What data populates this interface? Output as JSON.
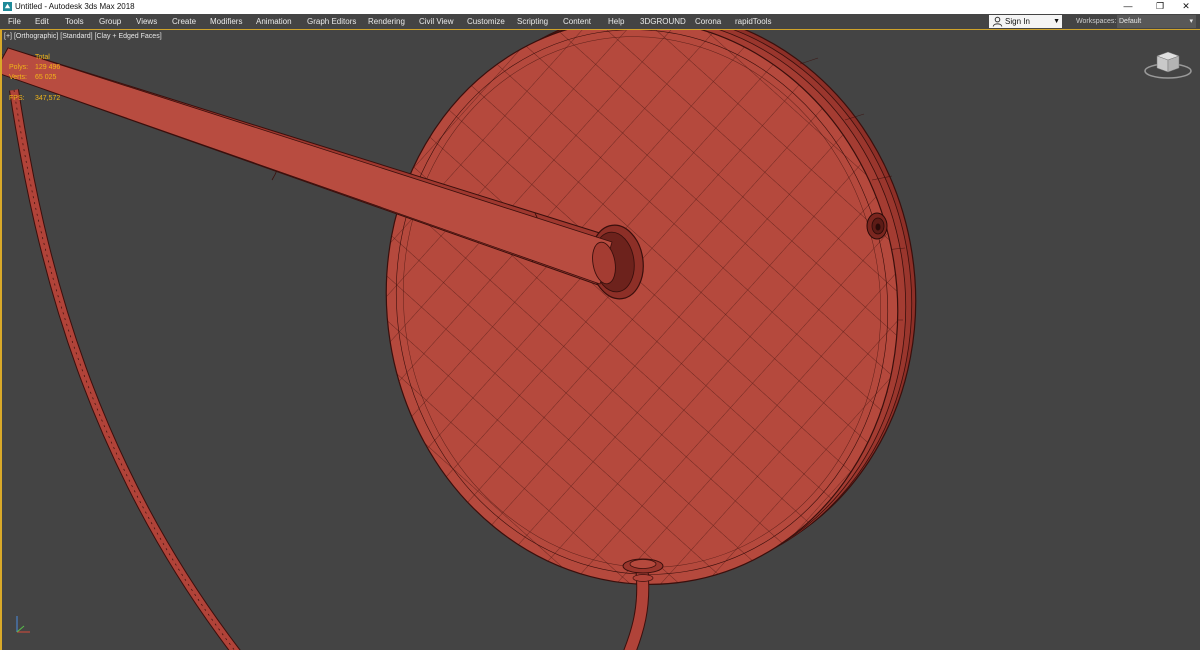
{
  "window": {
    "title": "Untitled - Autodesk 3ds Max 2018",
    "minimize_glyph": "—",
    "maximize_glyph": "❐",
    "close_glyph": "✕"
  },
  "menu": {
    "items": [
      "File",
      "Edit",
      "Tools",
      "Group",
      "Views",
      "Create",
      "Modifiers",
      "Animation",
      "Graph Editors",
      "Rendering",
      "Civil View",
      "Customize",
      "Scripting",
      "Content",
      "Help",
      "3DGROUND",
      "Corona",
      "rapidTools"
    ]
  },
  "account": {
    "sign_in": "Sign In",
    "workspaces_label": "Workspaces:",
    "workspace_value": "Default"
  },
  "viewport": {
    "label_plus": "[+]",
    "label_view": "[Orthographic]",
    "label_shading_style": "[Standard]",
    "label_shading": "[Clay + Edged Faces]",
    "stats": {
      "total_label": "Total",
      "polys_label": "Polys:",
      "polys_value": "129 496",
      "verts_label": "Verts:",
      "verts_value": "65 025",
      "fps_label": "FPS:",
      "fps_value": "347,572"
    }
  },
  "colors": {
    "accent_border": "#d9a929",
    "model_clay": "#b5493d",
    "wire": "#3a0f0c",
    "stats_text": "#f2b619",
    "viewport_bg": "#444444"
  },
  "icons": {
    "app": "3dsmax-app-icon",
    "user": "user-icon",
    "viewcube": "viewcube-icon",
    "axis": "axis-tripod-icon"
  }
}
